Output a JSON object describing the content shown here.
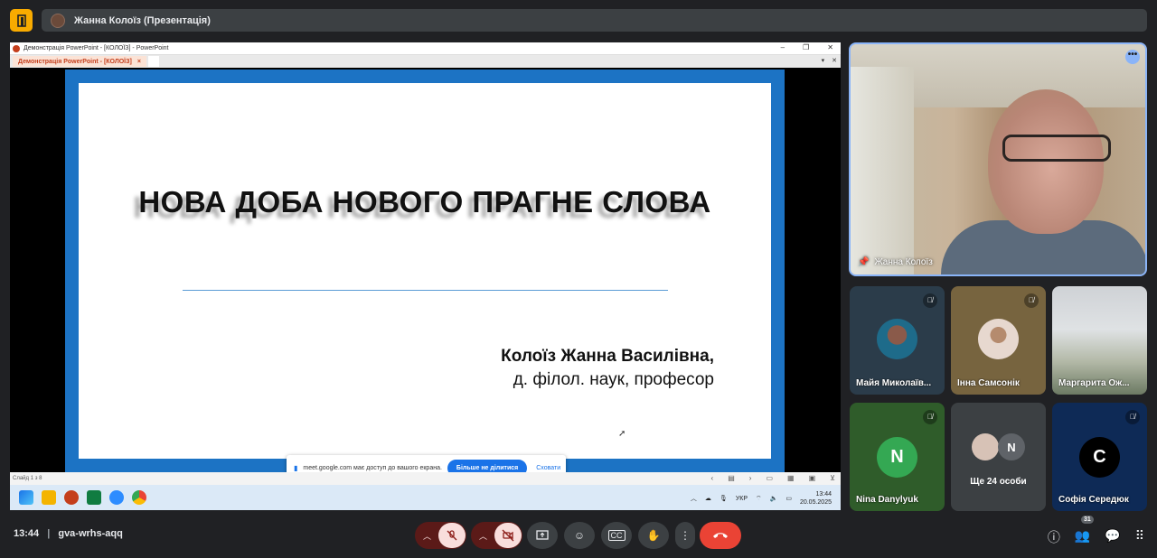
{
  "topbar": {
    "presenter_chip": "Жанна Колоїз (Презентація)"
  },
  "window": {
    "title": "Демонстрація PowerPoint - [КОЛОЇЗ] - PowerPoint",
    "tab_label": "Демонстрація PowerPoint - [КОЛОЇЗ]",
    "tab_close": "×"
  },
  "slide": {
    "title": "НОВА ДОБА НОВОГО ПРАГНЕ СЛОВА",
    "author": "Колоїз Жанна Василівна,",
    "degree": "д. філол. наук, професор"
  },
  "share_banner": {
    "message": "meet.google.com має доступ до вашого екрана.",
    "stop_label": "Більше не ділитися",
    "hide_label": "Сховати"
  },
  "statusbar": {
    "slide_info": "Слайд 1 з 8"
  },
  "taskbar": {
    "lang": "УКР",
    "time": "13:44",
    "date": "20.05.2025"
  },
  "main_tile": {
    "name": "Жанна Колоїз",
    "more": "•••"
  },
  "participants": [
    {
      "name": "Майя Миколаїв...",
      "avatar_color": "#1e6b8a"
    },
    {
      "name": "Інна Самсонік",
      "avatar_color": "#d7c2b6"
    },
    {
      "name": "Маргарита Ож...",
      "avatar_color": "#b2b8a6"
    },
    {
      "name": "Nina Danylyuk",
      "letter": "N",
      "avatar_color": "#34a853"
    },
    {
      "name": "Ще 24 особи",
      "letter": "N",
      "avatar_color": "#5f6368"
    },
    {
      "name": "Софія Середюк",
      "letter": "С",
      "avatar_color": "#000000"
    }
  ],
  "bottombar": {
    "time": "13:44",
    "separator": "|",
    "meeting_code": "gva-wrhs-aqq",
    "people_count": "31"
  },
  "colors": {
    "accent": "#8ab4f8",
    "leave": "#ea4335",
    "mic_off_bg": "#f9dedc"
  }
}
